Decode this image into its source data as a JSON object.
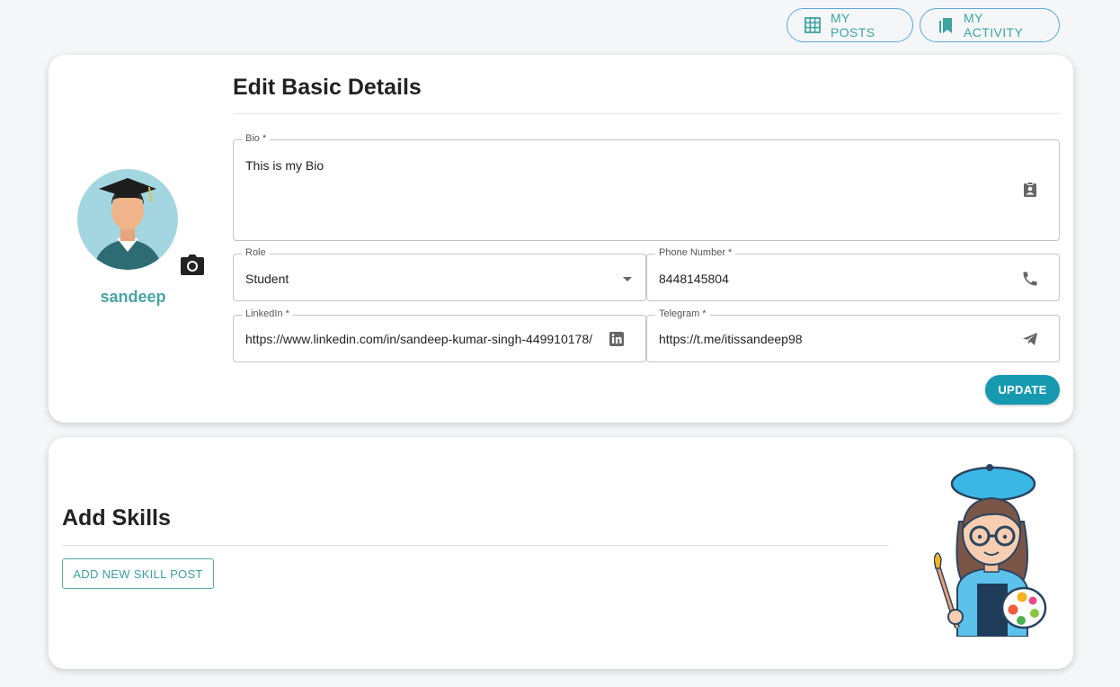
{
  "header": {
    "my_posts_label": "MY POSTS",
    "my_activity_label": "MY ACTIVITY",
    "my_posts_icon": "grid-icon",
    "my_activity_icon": "bookmarks-icon"
  },
  "profile": {
    "username": "sandeep",
    "avatar": "graduate-avatar",
    "camera_icon": "camera-icon"
  },
  "details": {
    "title": "Edit Basic Details",
    "bio": {
      "label": "Bio *",
      "value": "This is my Bio",
      "icon": "contact-badge-icon"
    },
    "role": {
      "label": "Role",
      "value": "Student",
      "icon": "dropdown-arrow-icon"
    },
    "phone": {
      "label": "Phone Number *",
      "value": "8448145804",
      "icon": "phone-icon"
    },
    "linkedin": {
      "label": "LinkedIn *",
      "value": "https://www.linkedin.com/in/sandeep-kumar-singh-449910178/",
      "icon": "linkedin-icon"
    },
    "telegram": {
      "label": "Telegram *",
      "value": "https://t.me/itissandeep98",
      "icon": "telegram-icon"
    },
    "update_label": "UPDATE"
  },
  "skills": {
    "title": "Add Skills",
    "add_label": "ADD NEW SKILL POST",
    "illustration": "painter-illustration"
  },
  "colors": {
    "accent": "#4aa3a5",
    "button": "#1799b0",
    "outline": "#5aa9d6",
    "background": "#f4f6f8"
  }
}
